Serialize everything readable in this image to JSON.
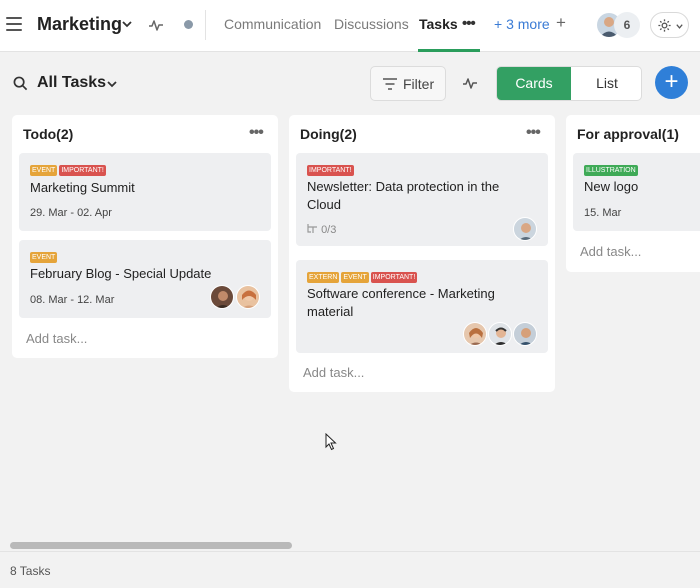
{
  "header": {
    "workspace_title": "Marketing",
    "tabs": [
      "Communication",
      "Discussions",
      "Tasks"
    ],
    "active_tab": "Tasks",
    "more_tabs": "+ 3 more",
    "member_count": "6",
    "accent_color": "#2a9d5c"
  },
  "toolbar": {
    "view_title": "All Tasks",
    "filter_label": "Filter",
    "view_modes": [
      "Cards",
      "List"
    ],
    "active_view": "Cards",
    "add_icon": "plus-icon",
    "primary_color": "#2f7fd8",
    "cards_color": "#33a063"
  },
  "columns": [
    {
      "title": "Todo(2)",
      "add_task": "Add task...",
      "cards": [
        {
          "tags": [
            "EVENT",
            "IMPORTANT!"
          ],
          "title": "Marketing Summit",
          "date": "29. Mar - 02. Apr"
        },
        {
          "tags": [
            "EVENT"
          ],
          "title": "February Blog - Special Update",
          "date": "08. Mar - 12. Mar"
        }
      ]
    },
    {
      "title": "Doing(2)",
      "add_task": "Add task...",
      "cards": [
        {
          "tags": [
            "IMPORTANT!"
          ],
          "title_lines": [
            "Newsletter: Data protection in the",
            "Cloud"
          ],
          "subtasks": "0/3"
        },
        {
          "tags": [
            "EXTERN",
            "EVENT",
            "IMPORTANT!"
          ],
          "title_lines": [
            "Software conference - Marketing",
            "material"
          ]
        }
      ]
    },
    {
      "title": "For approval(1)",
      "add_task": "Add task...",
      "cards": [
        {
          "tags": [
            "ILLUSTRATION"
          ],
          "title": "New logo",
          "date": "15. Mar"
        }
      ]
    }
  ],
  "tag_colors": {
    "EVENT": "#e5a43a",
    "IMPORTANT!": "#d9534f",
    "EXTERN": "#e5a43a",
    "ILLUSTRATION": "#3faa57"
  },
  "footer": {
    "task_count": "8 Tasks"
  }
}
